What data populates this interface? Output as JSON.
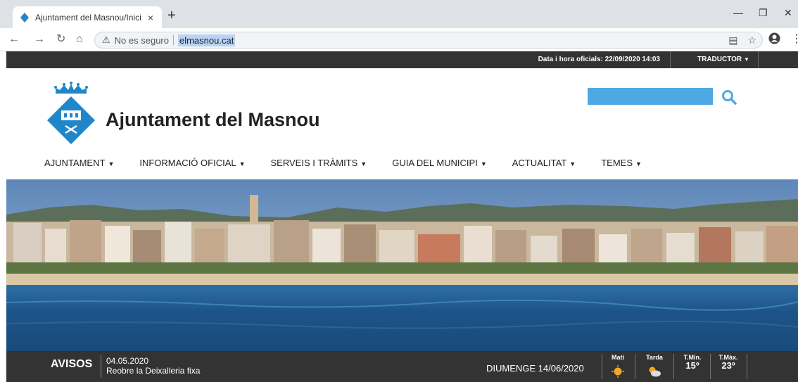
{
  "browser": {
    "tab_title": "Ajuntament del Masnou/Inici",
    "tab_close": "×",
    "new_tab": "+",
    "insecure_label": "No es seguro",
    "url": "elmasnou.cat"
  },
  "topbar": {
    "datetime": "Data i hora oficials: 22/09/2020 14:03",
    "translator": "TRADUCTOR"
  },
  "header": {
    "site_title": "Ajuntament del Masnou",
    "search_placeholder": ""
  },
  "nav": {
    "items": [
      {
        "label": "AJUNTAMENT"
      },
      {
        "label": "INFORMACIÓ OFICIAL"
      },
      {
        "label": "SERVEIS I TRÀMITS"
      },
      {
        "label": "GUIA DEL MUNICIPI"
      },
      {
        "label": "ACTUALITAT"
      },
      {
        "label": "TEMES"
      }
    ]
  },
  "bottombar": {
    "avisos_label": "AVISOS",
    "notice_date": "04.05.2020",
    "notice_text": "Reobre la Deixalleria fixa",
    "today": "DIUMENGE 14/06/2020",
    "morning_label": "Matí",
    "afternoon_label": "Tarda",
    "tmin_label": "T.Mín.",
    "tmin_value": "15º",
    "tmax_label": "T.Màx.",
    "tmax_value": "23º"
  },
  "colors": {
    "accent": "#4ea9e3",
    "logo_blue": "#1f87c9",
    "bar_dark": "#333333"
  }
}
